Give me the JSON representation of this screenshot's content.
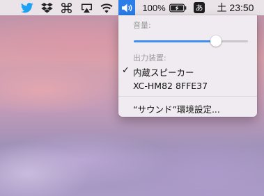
{
  "menubar": {
    "icons": [
      "twitter-icon",
      "dropbox-icon",
      "command-icon",
      "airplay-icon",
      "wifi-icon",
      "volume-icon",
      "battery-icon"
    ],
    "battery_percent": "100%",
    "input_method": "あ",
    "clock": "土 23:50"
  },
  "volume_menu": {
    "volume_header": "音量:",
    "volume_level": 0.72,
    "output_header": "出力装置:",
    "devices": [
      {
        "label": "内蔵スピーカー",
        "selected": true
      },
      {
        "label": "XC-HM82 8FFE37",
        "selected": false
      }
    ],
    "check_mark": "✓",
    "preferences_label": "“サウンド”環境設定..."
  },
  "colors": {
    "accent": "#2b7de8",
    "slider_fill": "#3d8ef0"
  }
}
